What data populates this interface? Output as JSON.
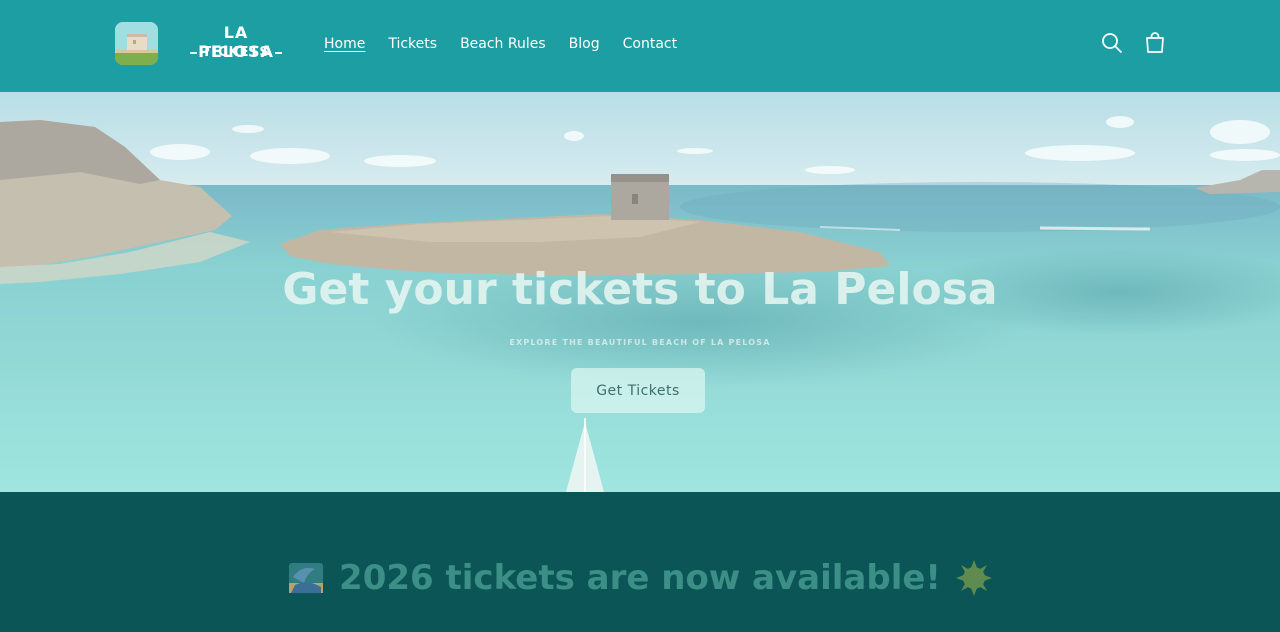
{
  "header": {
    "logo": {
      "line1": "LA PELOSA",
      "line2": "TICKETS"
    },
    "nav": [
      {
        "label": "Home",
        "active": true
      },
      {
        "label": "Tickets",
        "active": false
      },
      {
        "label": "Beach Rules",
        "active": false
      },
      {
        "label": "Blog",
        "active": false
      },
      {
        "label": "Contact",
        "active": false
      }
    ],
    "icons": {
      "search": "search-icon",
      "cart": "cart-icon"
    }
  },
  "hero": {
    "title": "Get your tickets to La Pelosa",
    "subtitle": "EXPLORE THE BEAUTIFUL BEACH OF LA PELOSA",
    "cta_label": "Get Tickets"
  },
  "announcement": {
    "text": "2026 tickets are now available!",
    "left_emoji": "beach-umbrella-icon",
    "right_emoji": "sun-icon"
  },
  "colors": {
    "header_bg": "#1d9ea3",
    "announcement_bg": "#0c5557",
    "announcement_text": "#3b8f86"
  }
}
